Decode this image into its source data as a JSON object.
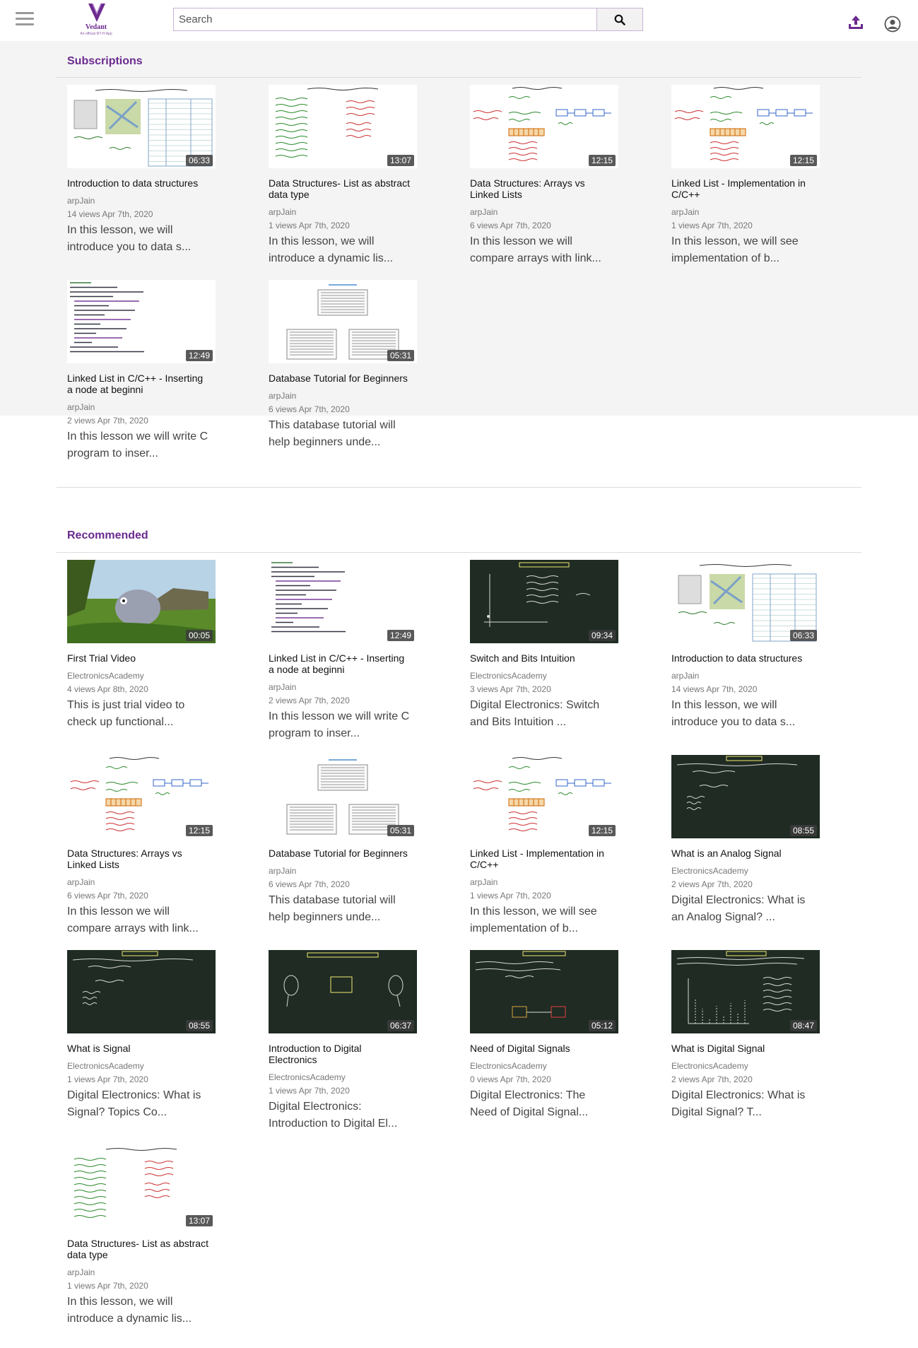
{
  "header": {
    "logo_name": "Vedant",
    "logo_tagline": "An official IIIT-H App",
    "search_placeholder": "Search"
  },
  "sections": {
    "subscriptions": "Subscriptions",
    "recommended": "Recommended"
  },
  "subscriptions": [
    {
      "title": "Introduction to data structures",
      "duration": "06:33",
      "channel": "arpJain",
      "meta": "14 views Apr 7th, 2020",
      "desc": "In this lesson, we will introduce you to data s...",
      "thumb": "ds-intro"
    },
    {
      "title": "Data Structures- List as abstract data type",
      "duration": "13:07",
      "channel": "arpJain",
      "meta": "1 views Apr 7th, 2020",
      "desc": "In this lesson, we will introduce a dynamic lis...",
      "thumb": "list-adt"
    },
    {
      "title": "Data Structures: Arrays vs Linked Lists",
      "duration": "12:15",
      "channel": "arpJain",
      "meta": "6 views Apr 7th, 2020",
      "desc": "In this lesson we will compare arrays with link...",
      "thumb": "array-ll"
    },
    {
      "title": "Linked List - Implementation in C/C++",
      "duration": "12:15",
      "channel": "arpJain",
      "meta": "1 views Apr 7th, 2020",
      "desc": "In this lesson, we will see implementation of b...",
      "thumb": "array-ll"
    },
    {
      "title": "Linked List in C/C++ - Inserting a node at beginni",
      "duration": "12:49",
      "channel": "arpJain",
      "meta": "2 views Apr 7th, 2020",
      "desc": "In this lesson we will write C program to inser...",
      "thumb": "code"
    },
    {
      "title": "Database Tutorial for Beginners",
      "duration": "05:31",
      "channel": "arpJain",
      "meta": "6 views Apr 7th, 2020",
      "desc": "This database tutorial will help beginners unde...",
      "thumb": "db"
    }
  ],
  "recommended": [
    {
      "title": "First Trial Video",
      "duration": "00:05",
      "channel": "ElectronicsAcademy",
      "meta": "4 views Apr 8th, 2020",
      "desc": "This is just trial video to check up functional...",
      "thumb": "nature"
    },
    {
      "title": "Linked List in C/C++ - Inserting a node at beginni",
      "duration": "12:49",
      "channel": "arpJain",
      "meta": "2 views Apr 7th, 2020",
      "desc": "In this lesson we will write C program to inser...",
      "thumb": "code"
    },
    {
      "title": "Switch and Bits Intuition",
      "duration": "09:34",
      "channel": "ElectronicsAcademy",
      "meta": "3 views Apr 7th, 2020",
      "desc": "Digital Electronics: Switch and Bits Intuition ...",
      "thumb": "board-switch"
    },
    {
      "title": "Introduction to data structures",
      "duration": "06:33",
      "channel": "arpJain",
      "meta": "14 views Apr 7th, 2020",
      "desc": "In this lesson, we will introduce you to data s...",
      "thumb": "ds-intro"
    },
    {
      "title": "Data Structures: Arrays vs Linked Lists",
      "duration": "12:15",
      "channel": "arpJain",
      "meta": "6 views Apr 7th, 2020",
      "desc": "In this lesson we will compare arrays with link...",
      "thumb": "array-ll"
    },
    {
      "title": "Database Tutorial for Beginners",
      "duration": "05:31",
      "channel": "arpJain",
      "meta": "6 views Apr 7th, 2020",
      "desc": "This database tutorial will help beginners unde...",
      "thumb": "db"
    },
    {
      "title": "Linked List - Implementation in C/C++",
      "duration": "12:15",
      "channel": "arpJain",
      "meta": "1 views Apr 7th, 2020",
      "desc": "In this lesson, we will see implementation of b...",
      "thumb": "array-ll"
    },
    {
      "title": "What is an Analog Signal",
      "duration": "08:55",
      "channel": "ElectronicsAcademy",
      "meta": "2 views Apr 7th, 2020",
      "desc": "Digital Electronics: What is an Analog Signal? ...",
      "thumb": "board-signal"
    },
    {
      "title": "What is Signal",
      "duration": "08:55",
      "channel": "ElectronicsAcademy",
      "meta": "1 views Apr 7th, 2020",
      "desc": "Digital Electronics: What is Signal? Topics Co...",
      "thumb": "board-signal"
    },
    {
      "title": "Introduction to Digital Electronics",
      "duration": "06:37",
      "channel": "ElectronicsAcademy",
      "meta": "1 views Apr 7th, 2020",
      "desc": "Digital Electronics: Introduction to Digital El...",
      "thumb": "board-intro"
    },
    {
      "title": "Need of Digital Signals",
      "duration": "05:12",
      "channel": "ElectronicsAcademy",
      "meta": "0 views Apr 7th, 2020",
      "desc": "Digital Electronics: The Need of Digital Signal...",
      "thumb": "board-need"
    },
    {
      "title": "What is Digital Signal",
      "duration": "08:47",
      "channel": "ElectronicsAcademy",
      "meta": "2 views Apr 7th, 2020",
      "desc": "Digital Electronics: What is Digital Signal? T...",
      "thumb": "board-digital"
    },
    {
      "title": "Data Structures- List as abstract data type",
      "duration": "13:07",
      "channel": "arpJain",
      "meta": "1 views Apr 7th, 2020",
      "desc": "In this lesson, we will introduce a dynamic lis...",
      "thumb": "list-adt"
    }
  ],
  "colors": {
    "accent": "#6b2a8f",
    "chalkboard": "#1f2b23"
  },
  "icons": {
    "menu": "hamburger-icon",
    "search": "search-icon",
    "upload": "upload-icon",
    "account": "account-circle-icon"
  }
}
